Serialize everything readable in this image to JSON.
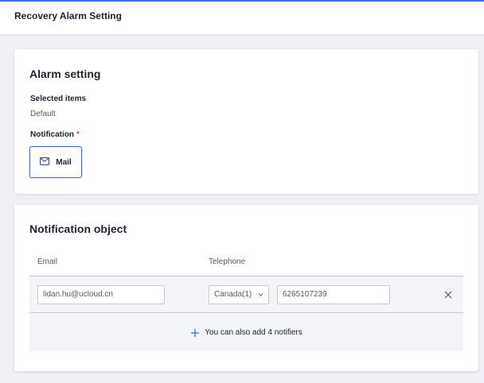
{
  "header": {
    "title": "Recovery Alarm Setting"
  },
  "alarm_setting": {
    "title": "Alarm setting",
    "selected_items_label": "Selected items",
    "selected_items_value": "Default",
    "notification_label": "Notification",
    "required_mark": "*",
    "mail_button_label": "Mail"
  },
  "notification_object": {
    "title": "Notification object",
    "columns": {
      "email": "Email",
      "telephone": "Telephone"
    },
    "rows": [
      {
        "email": "lidan.hu@ucloud.cn",
        "country": "Canada(1)",
        "phone": "6265107239"
      }
    ],
    "add_text": "You can also add 4 notifiers"
  },
  "icons": {
    "mail": "mail-icon",
    "chevron": "chevron-down-icon",
    "close": "close-icon",
    "plus": "plus-icon"
  },
  "colors": {
    "accent": "#3a6cf0",
    "required": "#e5484d"
  }
}
